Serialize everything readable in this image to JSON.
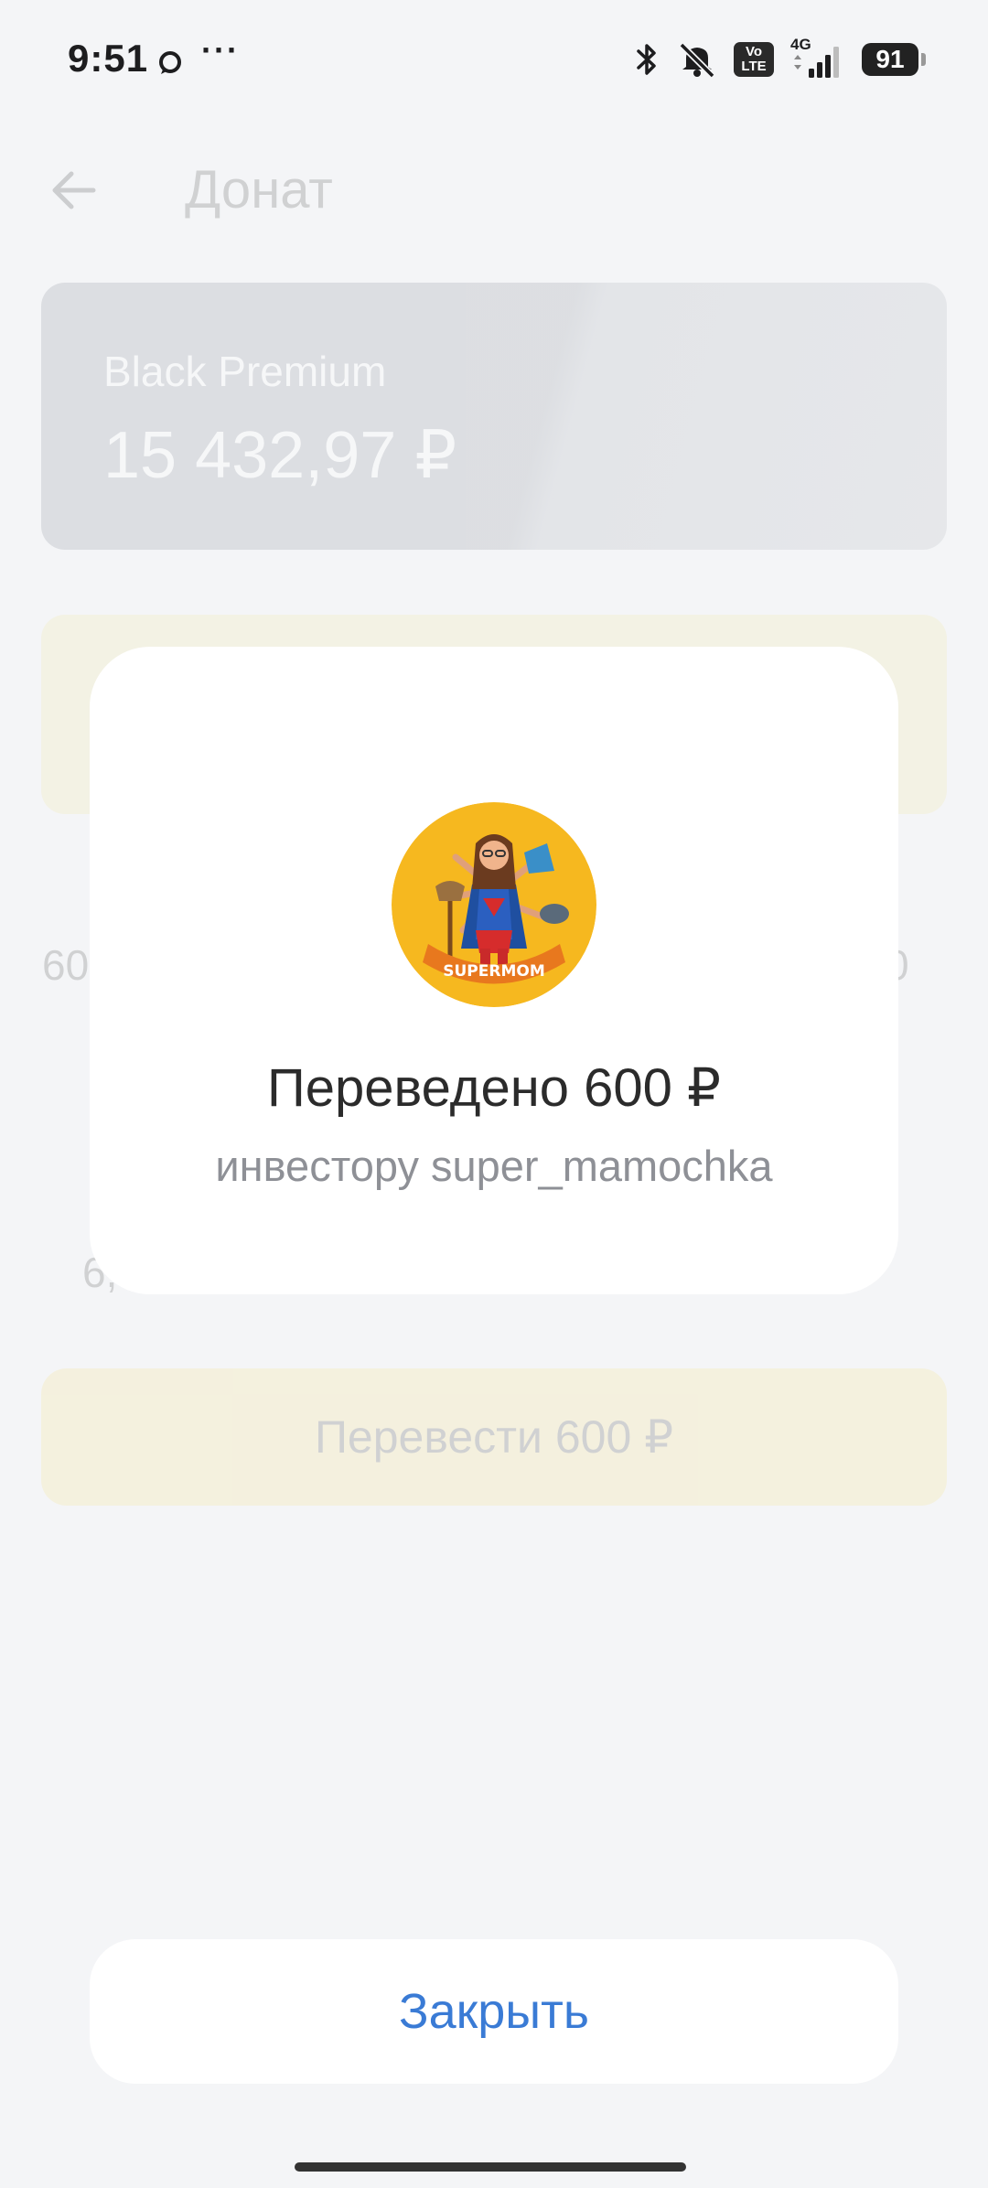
{
  "status_bar": {
    "time": "9:51",
    "more": "···",
    "battery": "91",
    "network": "4G",
    "volte_top": "Vo",
    "volte_bottom": "LTE",
    "icons": [
      "message-icon",
      "bluetooth-icon",
      "mute-icon",
      "volte-icon",
      "signal-icon",
      "battery-icon"
    ]
  },
  "background": {
    "title": "Донат",
    "card": {
      "name": "Black Premium",
      "balance": "15 432,97 ₽"
    },
    "fragments": {
      "left_amount": "60",
      "right_amount": "0",
      "left_line": "6,"
    },
    "primary_button": "Перевести 600 ₽"
  },
  "modal": {
    "avatar_label": "SUPERMOM",
    "title": "Переведено 600 ₽",
    "subtitle": "инвестору super_mamochka"
  },
  "close_button": "Закрыть"
}
